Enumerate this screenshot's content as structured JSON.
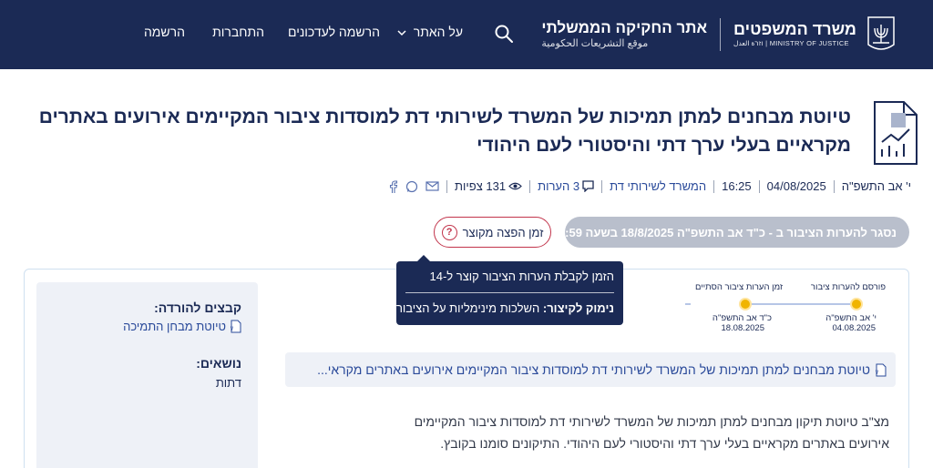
{
  "header": {
    "moj_title": "משרד המשפטים",
    "moj_en": "MINISTRY OF JUSTICE | וזרة العدل",
    "site_title": "אתר החקיקה הממשלתי",
    "site_subtitle": "موقع التشريعات الحكومية",
    "nav": {
      "about": "על האתר",
      "updates": "הרשמה לעדכונים",
      "login": "התחברות",
      "register": "הרשמה"
    },
    "icons": {
      "search": "search-icon",
      "chevron": "chevron-down-icon",
      "emblem": "menorah-emblem-icon"
    }
  },
  "page": {
    "title": "טיוטת מבחנים למתן תמיכות של המשרד לשירותי דת למוסדות ציבור המקיימים אירועים באתרים מקראיים בעלי ערך דתי והיסטורי לעם היהודי",
    "meta": {
      "hebrew_date": "י' אב התשפ\"ה",
      "date": "04/08/2025",
      "time": "16:25",
      "office": "המשרד לשירותי דת",
      "comments": "3 הערות",
      "views": "131 צפיות"
    },
    "status": "נסגר להערות הציבור ב - כ\"ד אב התשפ\"ה 18/8/2025 בשעה 23:59",
    "short_time_label": "זמן הפצה מקוצר",
    "tooltip": {
      "line1": "הזמן לקבלת הערות הציבור קוצר ל-14",
      "reason_label": "נימוק לקיצור:",
      "reason_text": "השלכות מינימליות על הציבור"
    }
  },
  "timeline": {
    "published_label": "פורסם להערות ציבור",
    "published_hebrew": "י' אב התשפ\"ה",
    "published_date": "04.08.2025",
    "end_label": "זמן הערות ציבור הסתיים",
    "end_hebrew": "כ\"ד אב התשפ\"ה",
    "end_date": "18.08.2025"
  },
  "sidebar": {
    "downloads_title": "קבצים להורדה:",
    "download_file": "טיוטת מבחן התמיכה",
    "topics_title": "נושאים:",
    "topic": "דתות"
  },
  "file_row": {
    "label": "טיוטת מבחנים למתן תמיכות של המשרד לשירותי דת למוסדות ציבור המקיימים אירועים באתרים מקראי..."
  },
  "description": "מצ\"ב טיוטת תיקון מבחנים למתן תמיכות של המשרד לשירותי דת למוסדות ציבור המקיימים אירועים באתרים מקראיים בעלי ערך דתי והיסטורי לעם היהודי. התיקונים סומנו בקובץ.",
  "colors": {
    "navy": "#1b2a55",
    "accent_red": "#c2344b",
    "timeline_dot": "#f0b400",
    "status_gray": "#b9bfcc"
  }
}
